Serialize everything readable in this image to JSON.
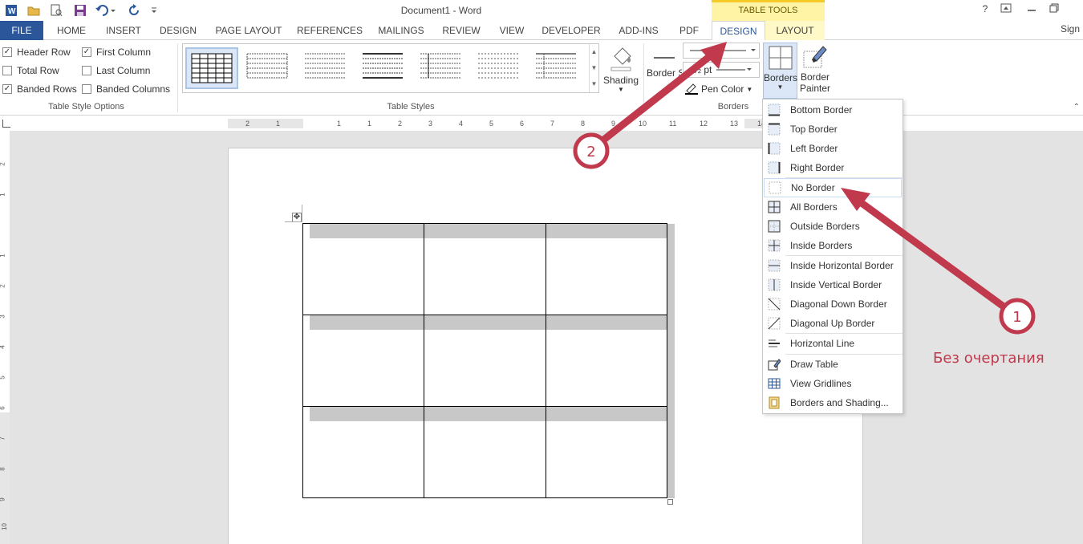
{
  "titlebar": {
    "doc_title": "Document1 - Word",
    "table_tools_label": "TABLE TOOLS",
    "qat_icons": [
      "word-app-icon",
      "open-icon",
      "print-preview-icon",
      "save-icon",
      "undo-icon",
      "redo-icon",
      "customize-qat-icon"
    ]
  },
  "tabs": {
    "file": "FILE",
    "home": "HOME",
    "insert": "INSERT",
    "design": "DESIGN",
    "page_layout": "PAGE LAYOUT",
    "references": "REFERENCES",
    "mailings": "MAILINGS",
    "review": "REVIEW",
    "view": "VIEW",
    "developer": "DEVELOPER",
    "addins": "ADD-INS",
    "pdf": "PDF",
    "ctx_design": "DESIGN",
    "ctx_layout": "LAYOUT",
    "sign_in": "Sign"
  },
  "window": {
    "help": "?",
    "ribbon_display": "⇪",
    "minimize": "—",
    "restore": "❐"
  },
  "style_options": {
    "header_row": "Header Row",
    "first_column": "First Column",
    "total_row": "Total Row",
    "last_column": "Last Column",
    "banded_rows": "Banded Rows",
    "banded_columns": "Banded Columns",
    "group_label": "Table Style Options",
    "checked": {
      "header_row": true,
      "first_column": true,
      "total_row": false,
      "last_column": false,
      "banded_rows": true,
      "banded_columns": false
    }
  },
  "table_styles": {
    "group_label": "Table Styles",
    "shading_label": "Shading"
  },
  "borders_group": {
    "border_styles_label": "Border Styles",
    "line_weight": "½ pt",
    "pen_color_label": "Pen Color",
    "borders_label": "Borders",
    "border_painter_label_1": "Border",
    "border_painter_label_2": "Painter",
    "group_label": "Borders"
  },
  "ruler": {
    "h_labels": [
      "2",
      "1",
      "1",
      "1",
      "2",
      "3",
      "4",
      "5",
      "6",
      "7",
      "8",
      "9",
      "10",
      "11",
      "12",
      "13",
      "14"
    ],
    "v_labels": [
      "2",
      "1",
      "1",
      "2",
      "3",
      "4",
      "5",
      "6",
      "7",
      "8",
      "9",
      "10"
    ]
  },
  "borders_menu": {
    "items": [
      {
        "label": "Bottom Border",
        "icon": "bottom-border-icon"
      },
      {
        "label": "Top Border",
        "icon": "top-border-icon"
      },
      {
        "label": "Left Border",
        "icon": "left-border-icon"
      },
      {
        "label": "Right Border",
        "icon": "right-border-icon"
      },
      {
        "label": "No Border",
        "icon": "no-border-icon"
      },
      {
        "label": "All Borders",
        "icon": "all-borders-icon"
      },
      {
        "label": "Outside Borders",
        "icon": "outside-borders-icon"
      },
      {
        "label": "Inside Borders",
        "icon": "inside-borders-icon"
      },
      {
        "label": "Inside Horizontal Border",
        "icon": "inside-horizontal-border-icon"
      },
      {
        "label": "Inside Vertical Border",
        "icon": "inside-vertical-border-icon"
      },
      {
        "label": "Diagonal Down Border",
        "icon": "diagonal-down-border-icon"
      },
      {
        "label": "Diagonal Up Border",
        "icon": "diagonal-up-border-icon"
      },
      {
        "label": "Horizontal Line",
        "icon": "horizontal-line-icon"
      },
      {
        "label": "Draw Table",
        "icon": "draw-table-icon"
      },
      {
        "label": "View Gridlines",
        "icon": "view-gridlines-icon"
      },
      {
        "label": "Borders and Shading...",
        "icon": "borders-shading-icon"
      }
    ]
  },
  "annotations": {
    "step1": "1",
    "step2": "2",
    "caption": "Без очертания",
    "color": "#c0394c"
  },
  "colors": {
    "file_tab": "#2b579a",
    "accent": "#2b579a",
    "table_tools_band": "#fff3a6",
    "table_tools_border": "#f5c928",
    "header_shade": "#c8c8c8"
  }
}
